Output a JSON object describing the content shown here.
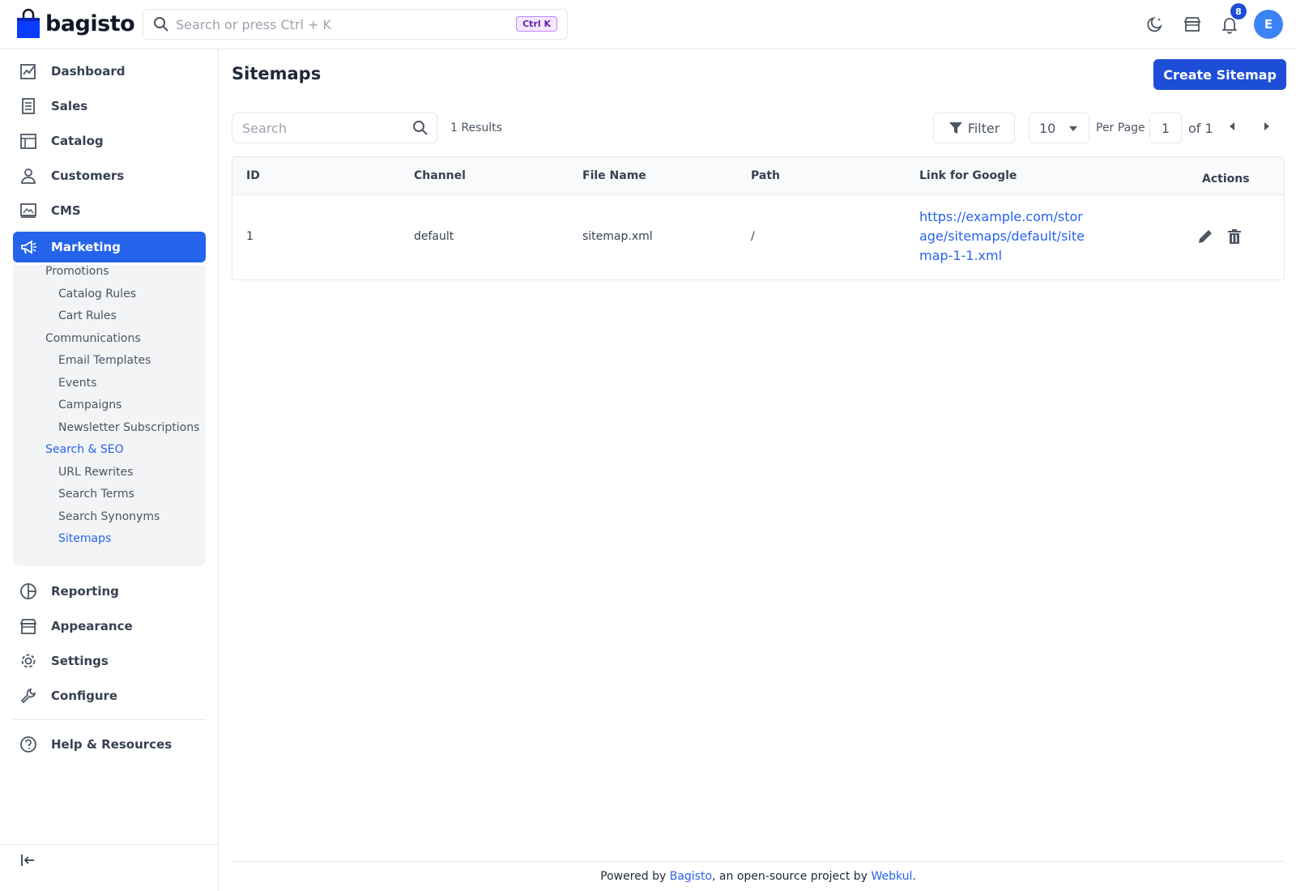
{
  "app": {
    "brand": "bagisto",
    "search_placeholder": "Search or press Ctrl + K",
    "shortcut": "Ctrl K",
    "notifications_count": "8",
    "user_initial": "E"
  },
  "sidebar": {
    "items": [
      {
        "label": "Dashboard",
        "icon": "dashboard-icon"
      },
      {
        "label": "Sales",
        "icon": "sales-icon"
      },
      {
        "label": "Catalog",
        "icon": "catalog-icon"
      },
      {
        "label": "Customers",
        "icon": "customers-icon"
      },
      {
        "label": "CMS",
        "icon": "cms-icon"
      },
      {
        "label": "Marketing",
        "icon": "marketing-icon",
        "active": true
      },
      {
        "label": "Reporting",
        "icon": "reporting-icon"
      },
      {
        "label": "Appearance",
        "icon": "appearance-icon"
      },
      {
        "label": "Settings",
        "icon": "settings-icon"
      },
      {
        "label": "Configure",
        "icon": "configure-icon"
      },
      {
        "label": "Help & Resources",
        "icon": "help-icon"
      }
    ],
    "submenu": {
      "promotions": "Promotions",
      "catalog_rules": "Catalog Rules",
      "cart_rules": "Cart Rules",
      "communications": "Communications",
      "email_templates": "Email Templates",
      "events": "Events",
      "campaigns": "Campaigns",
      "newsletter_subscriptions": "Newsletter Subscriptions",
      "search_seo": "Search & SEO",
      "url_rewrites": "URL Rewrites",
      "search_terms": "Search Terms",
      "search_synonyms": "Search Synonyms",
      "sitemaps": "Sitemaps"
    }
  },
  "main": {
    "title": "Sitemaps",
    "create_button": "Create Sitemap",
    "search_placeholder": "Search",
    "results": "1 Results",
    "filter_label": "Filter",
    "per_page_value": "10",
    "per_page_label": "Per Page",
    "page_number": "1",
    "of_label": "of 1",
    "columns": [
      "ID",
      "Channel",
      "File Name",
      "Path",
      "Link for Google",
      "Actions"
    ],
    "rows": [
      {
        "id": "1",
        "channel": "default",
        "file_name": "sitemap.xml",
        "path": "/",
        "link": "https://example.com/storage/sitemaps/default/sitemap-1-1.xml"
      }
    ]
  },
  "footer": {
    "prefix": "Powered by ",
    "bagisto": "Bagisto",
    "middle": ", an open-source project by ",
    "webkul": "Webkul",
    "suffix": "."
  },
  "colors": {
    "accent": "#2563eb",
    "button": "#1d4ed8"
  }
}
